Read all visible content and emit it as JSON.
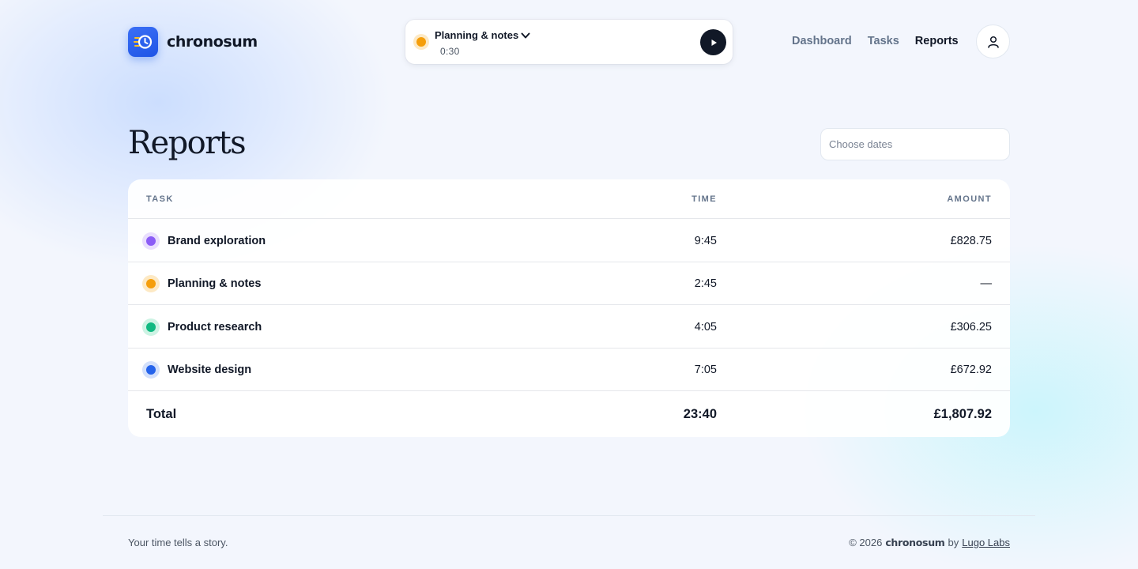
{
  "brand": {
    "name": "chronosum",
    "icon": "clock-history-icon",
    "accent": "#2563eb"
  },
  "timer": {
    "task": "Planning & notes",
    "elapsed": "0:30",
    "dot_color": "#f59e0b",
    "play_icon": "play-icon",
    "dropdown_icon": "chevron-down-icon"
  },
  "nav": {
    "items": [
      "Dashboard",
      "Tasks",
      "Reports"
    ],
    "active": "Reports",
    "profile_icon": "user-icon"
  },
  "page": {
    "title": "Reports",
    "date_placeholder": "Choose dates"
  },
  "table": {
    "headers": {
      "task": "TASK",
      "time": "TIME",
      "amount": "AMOUNT"
    },
    "rows": [
      {
        "task": "Brand exploration",
        "time": "9:45",
        "amount": "£828.75",
        "color": "#8b5cf6",
        "ring": "#e9defe"
      },
      {
        "task": "Planning & notes",
        "time": "2:45",
        "amount": "—",
        "color": "#f59e0b",
        "ring": "#fde9c4"
      },
      {
        "task": "Product research",
        "time": "4:05",
        "amount": "£306.25",
        "color": "#10b981",
        "ring": "#cdf3e4"
      },
      {
        "task": "Website design",
        "time": "7:05",
        "amount": "£672.92",
        "color": "#2563eb",
        "ring": "#d3e0fb"
      }
    ],
    "total": {
      "label": "Total",
      "time": "23:40",
      "amount": "£1,807.92"
    }
  },
  "footer": {
    "tagline": "Your time tells a story.",
    "copyright": "© 2026",
    "brand": "chronosum",
    "by": "by",
    "company": "Lugo Labs"
  }
}
